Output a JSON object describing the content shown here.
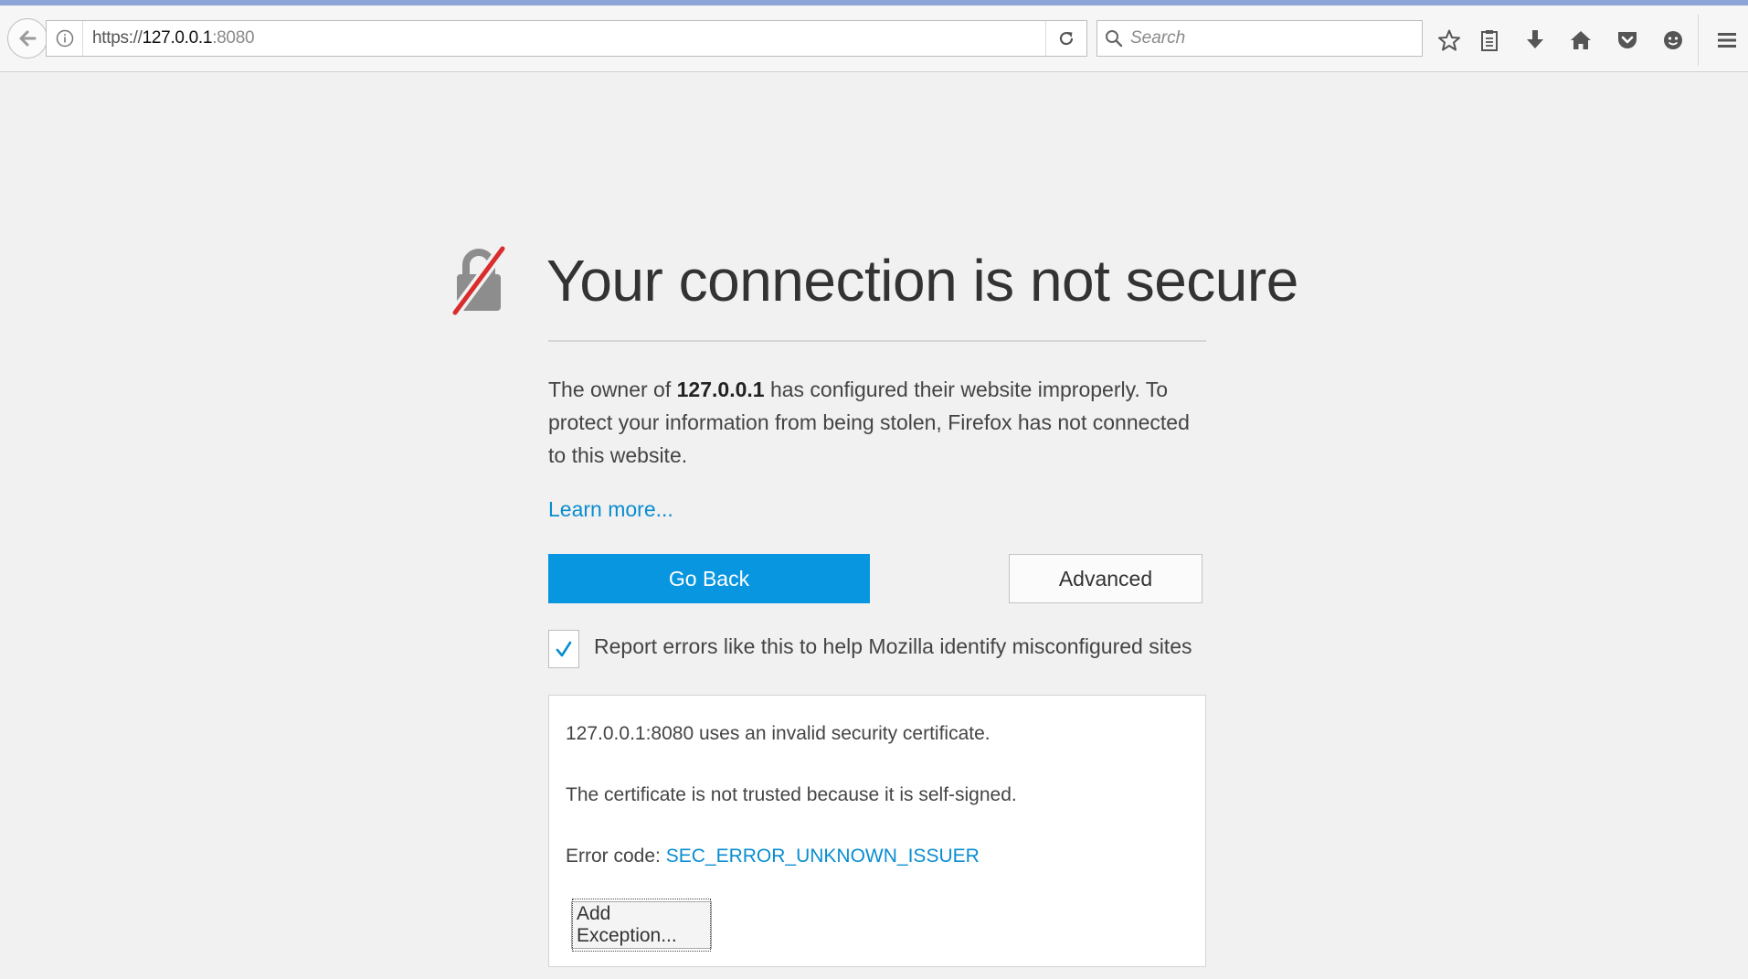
{
  "browser": {
    "url_scheme": "https://",
    "url_host": "127.0.0.1",
    "url_port": ":8080",
    "search_placeholder": "Search",
    "toolbar_icons": [
      "star-icon",
      "reading-list-icon",
      "download-icon",
      "home-icon",
      "pocket-icon",
      "account-icon",
      "menu-icon"
    ]
  },
  "error_page": {
    "title": "Your connection is not secure",
    "description_pre": "The owner of ",
    "description_host": "127.0.0.1",
    "description_post": " has configured their website improperly. To protect your information from being stolen, Firefox has not connected to this website.",
    "learn_more": "Learn more...",
    "go_back": "Go Back",
    "advanced": "Advanced",
    "report_label": "Report errors like this to help Mozilla identify misconfigured sites",
    "report_checked": true,
    "details": {
      "line1": "127.0.0.1:8080 uses an invalid security certificate.",
      "line2": "The certificate is not trusted because it is self-signed.",
      "error_code_label": "Error code: ",
      "error_code": "SEC_ERROR_UNKNOWN_ISSUER",
      "add_exception": "Add Exception..."
    }
  },
  "colors": {
    "accent": "#0996e0",
    "link": "#0a8dd0",
    "lock_slash": "#d92d2d"
  }
}
